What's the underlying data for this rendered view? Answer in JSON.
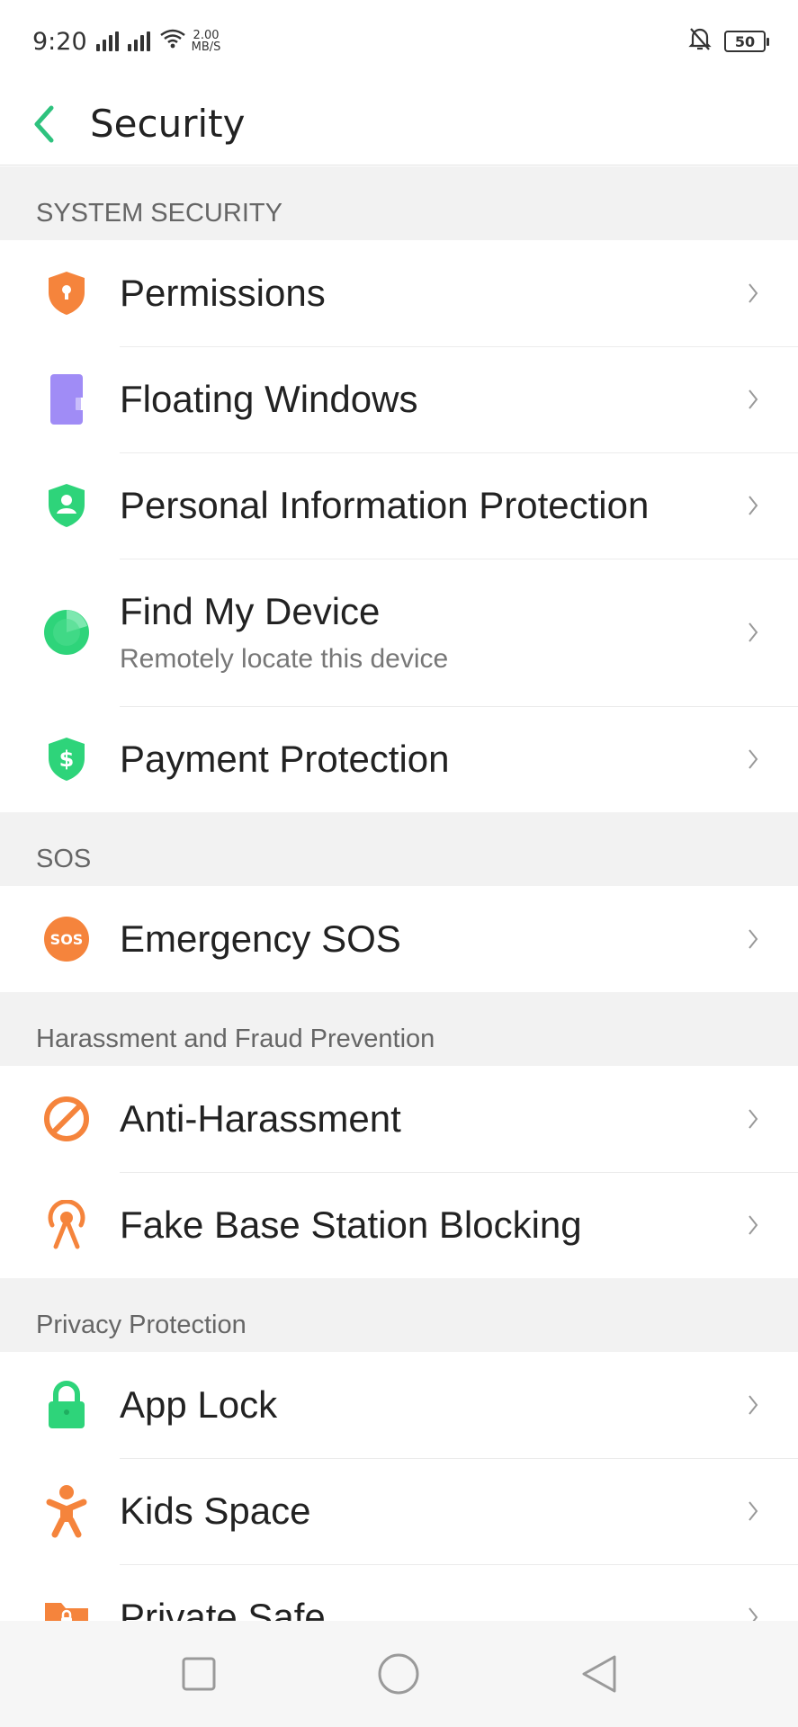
{
  "status_bar": {
    "time": "9:20",
    "net_speed_value": "2.00",
    "net_speed_unit": "MB/S",
    "battery_level": "50"
  },
  "header": {
    "title": "Security",
    "back_icon": "chevron-left-icon"
  },
  "colors": {
    "accent": "#2ec27e",
    "orange": "#f5843c",
    "purple": "#9b87f5",
    "green": "#2ed47a"
  },
  "sections": [
    {
      "title": "SYSTEM SECURITY",
      "items": [
        {
          "label": "Permissions",
          "icon": "shield-lock-icon"
        },
        {
          "label": "Floating Windows",
          "icon": "floating-window-icon"
        },
        {
          "label": "Personal Information Protection",
          "icon": "shield-person-icon"
        },
        {
          "label": "Find My Device",
          "sublabel": "Remotely locate this device",
          "icon": "locate-device-icon"
        },
        {
          "label": "Payment Protection",
          "icon": "shield-dollar-icon"
        }
      ]
    },
    {
      "title": "SOS",
      "items": [
        {
          "label": "Emergency SOS",
          "icon": "sos-icon",
          "icon_text": "SOS"
        }
      ]
    },
    {
      "title": "Harassment and Fraud Prevention",
      "items": [
        {
          "label": "Anti-Harassment",
          "icon": "block-icon"
        },
        {
          "label": "Fake Base Station Blocking",
          "icon": "antenna-tower-icon"
        }
      ]
    },
    {
      "title": "Privacy Protection",
      "items": [
        {
          "label": "App Lock",
          "icon": "padlock-icon"
        },
        {
          "label": "Kids Space",
          "icon": "child-icon"
        },
        {
          "label": "Private Safe",
          "icon": "folder-lock-icon"
        }
      ]
    }
  ],
  "nav_bar": {
    "recents_icon": "square-icon",
    "home_icon": "circle-icon",
    "back_icon": "triangle-back-icon"
  }
}
